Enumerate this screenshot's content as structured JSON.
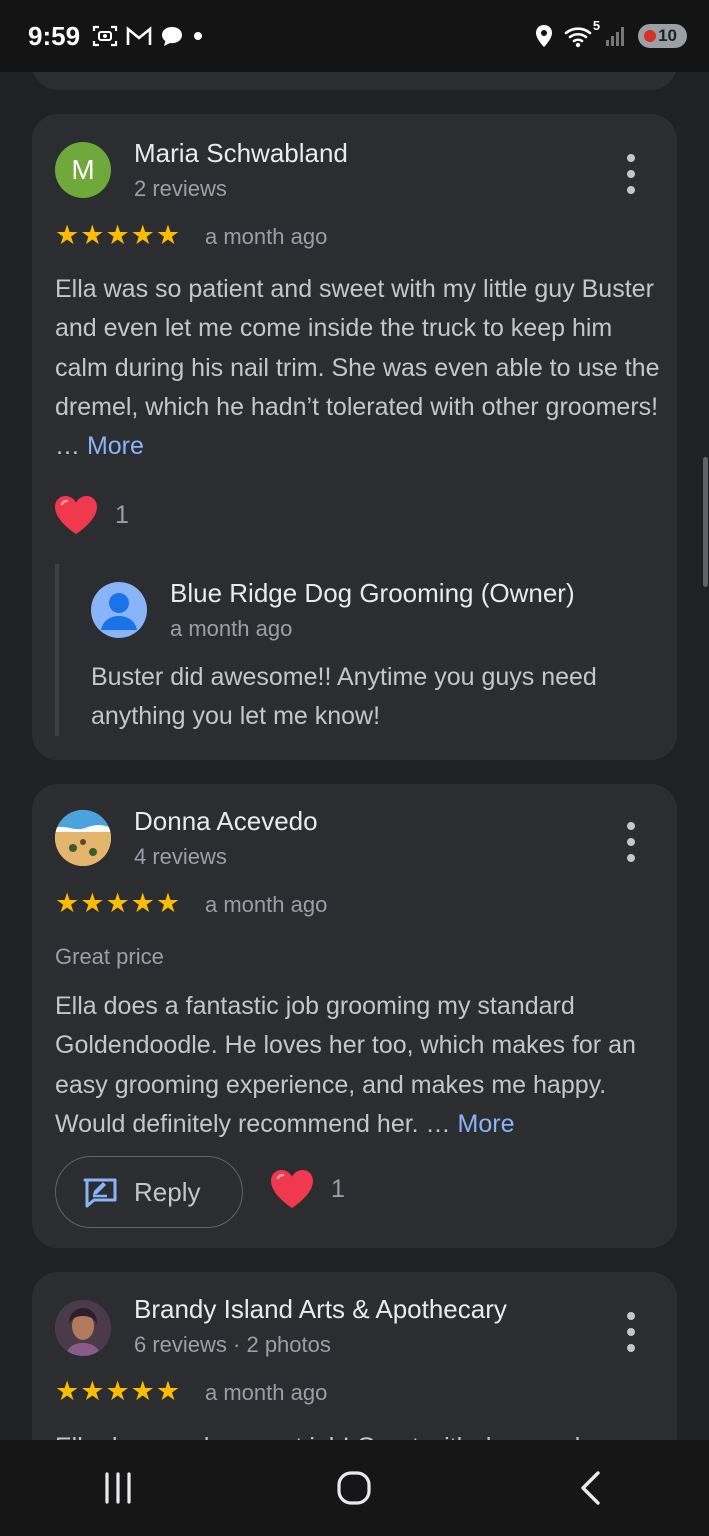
{
  "status_bar": {
    "time": "9:59",
    "left_icons": [
      "screenshot-icon",
      "gmail-icon",
      "chat-bubble-icon",
      "dot-icon"
    ],
    "right_icons": [
      "location-icon",
      "wifi-icon",
      "signal-icon"
    ],
    "wifi_badge": "5",
    "battery": "10"
  },
  "reviews": [
    {
      "avatar_letter": "M",
      "avatar_color": "#6fa83b",
      "name": "Maria Schwabland",
      "meta": "2 reviews",
      "rating": 5,
      "when": "a month ago",
      "text": "Ella was so patient and sweet with my little guy Buster and even let me come inside the truck to keep him calm during his nail trim. She was even able to use the dremel, which he hadn’t tolerated with other groomers! …",
      "more": "More",
      "likes": "1",
      "owner_reply": {
        "name": "Blue Ridge Dog Grooming (Owner)",
        "when": "a month ago",
        "text": "Buster did awesome!! Anytime you guys need anything you let me know!"
      }
    },
    {
      "name": "Donna Acevedo",
      "meta": "4 reviews",
      "rating": 5,
      "when": "a month ago",
      "tag": "Great price",
      "text": "Ella does a fantastic job grooming my standard Goldendoodle. He loves her too, which makes for an easy grooming experience, and makes me happy. Would definitely recommend her. …",
      "more": "More",
      "reply_label": "Reply",
      "likes": "1"
    },
    {
      "name": "Brandy Island Arts & Apothecary",
      "meta": "6 reviews · 2 photos",
      "rating": 5,
      "when": "a month ago",
      "text": "Ella does such a great job! Great with dogs and"
    }
  ],
  "colors": {
    "background": "#202124",
    "card": "#2b2d30",
    "star": "#fbbc04",
    "link": "#8ab4f8",
    "heart": "#f0384f"
  },
  "nav_bar": {
    "buttons": [
      "recents-icon",
      "home-icon",
      "back-icon"
    ]
  }
}
